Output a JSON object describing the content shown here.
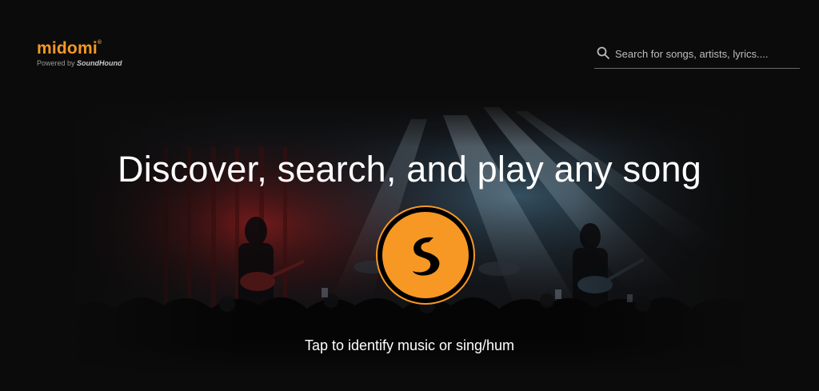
{
  "header": {
    "logo": {
      "word": "midomi",
      "registered": "®",
      "powered_prefix": "Powered by",
      "powered_brand": "SoundHound"
    },
    "search": {
      "placeholder": "Search for songs, artists, lyrics....",
      "icon": "search-icon"
    }
  },
  "hero": {
    "headline": "Discover, search, and play any song",
    "button_icon": "soundhound-icon",
    "tap_text": "Tap to identify music or sing/hum"
  },
  "colors": {
    "accent": "#f79824",
    "background": "#0b0b0b"
  }
}
